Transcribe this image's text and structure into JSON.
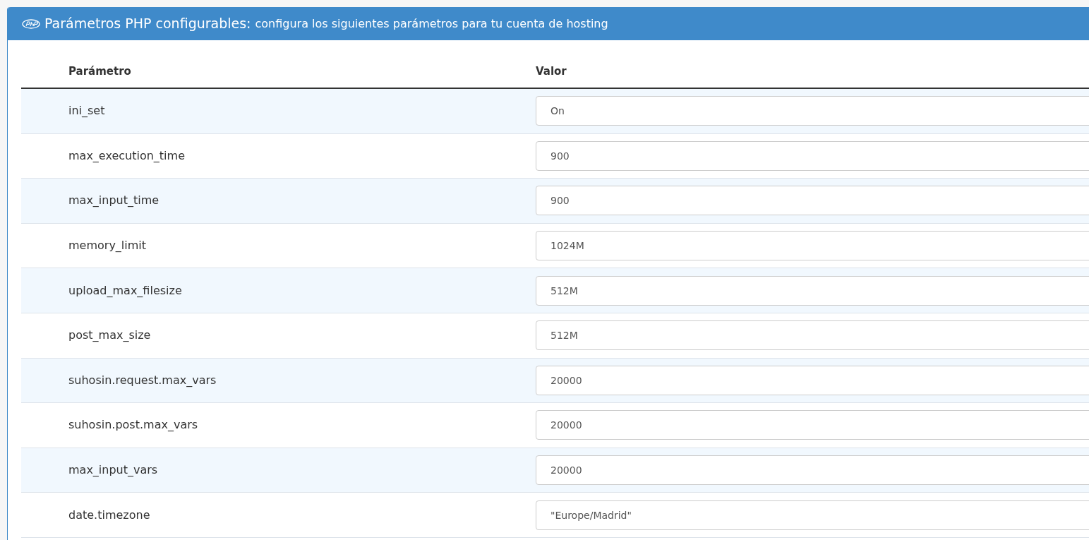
{
  "panel": {
    "title": "Parámetros PHP configurables:",
    "subtitle": "configura los siguientes parámetros para tu cuenta de hosting"
  },
  "table": {
    "columns": [
      "Parámetro",
      "Valor"
    ],
    "rows": [
      {
        "parameter": "ini_set",
        "value": "On"
      },
      {
        "parameter": "max_execution_time",
        "value": "900"
      },
      {
        "parameter": "max_input_time",
        "value": "900"
      },
      {
        "parameter": "memory_limit",
        "value": "1024M"
      },
      {
        "parameter": "upload_max_filesize",
        "value": "512M"
      },
      {
        "parameter": "post_max_size",
        "value": "512M"
      },
      {
        "parameter": "suhosin.request.max_vars",
        "value": "20000"
      },
      {
        "parameter": "suhosin.post.max_vars",
        "value": "20000"
      },
      {
        "parameter": "max_input_vars",
        "value": "20000"
      },
      {
        "parameter": "date.timezone",
        "value": "\"Europe/Madrid\""
      }
    ]
  }
}
